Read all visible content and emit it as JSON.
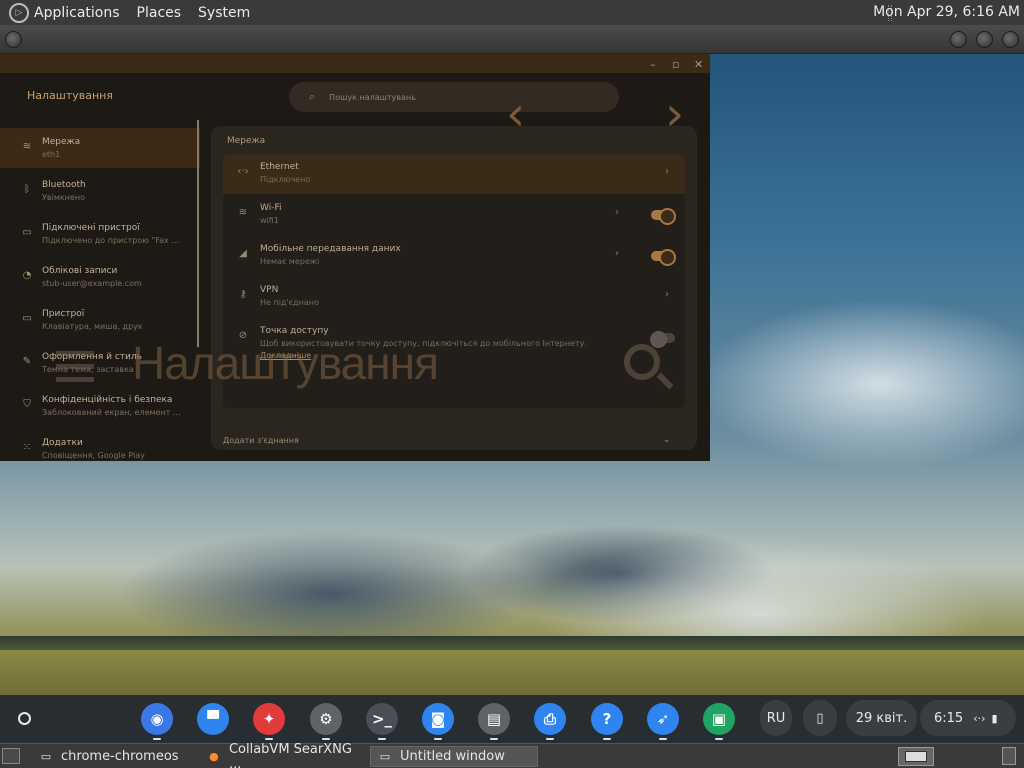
{
  "top_panel": {
    "menus": [
      "Applications",
      "Places",
      "System"
    ],
    "clock": "Mon Apr 29, 6:16 AM"
  },
  "settings": {
    "title": "Налаштування",
    "search_placeholder": "Пошук налаштувань",
    "overlay_title": "Налаштування",
    "nav": [
      {
        "title": "Мережа",
        "sub": "eth1",
        "icon": "wifi-icon"
      },
      {
        "title": "Bluetooth",
        "sub": "Увімкнено",
        "icon": "bluetooth-icon"
      },
      {
        "title": "Підключені пристрої",
        "sub": "Підключено до пристрою \"Fax ...",
        "icon": "connected-devices-icon"
      },
      {
        "title": "Облікові записи",
        "sub": "stub-user@example.com",
        "icon": "accounts-icon"
      },
      {
        "title": "Пристрої",
        "sub": "Клавіатура, миша, друк",
        "icon": "laptop-icon"
      },
      {
        "title": "Оформлення й стиль",
        "sub": "Темна тема, заставка",
        "icon": "palette-icon"
      },
      {
        "title": "Конфіденційність і безпека",
        "sub": "Заблокований екран, елемент ...",
        "icon": "shield-icon"
      },
      {
        "title": "Додатки",
        "sub": "Сповіщення, Google Play",
        "icon": "apps-grid-icon"
      }
    ],
    "section_heading": "Мережа",
    "rows": [
      {
        "title": "Ethernet",
        "sub": "Підключено",
        "icon": "ethernet-icon"
      },
      {
        "title": "Wi-Fi",
        "sub": "wifi1",
        "icon": "wifi-icon"
      },
      {
        "title": "Мобільне передавання даних",
        "sub": "Немає мережі",
        "icon": "cellular-icon"
      },
      {
        "title": "VPN",
        "sub": "Не під'єднано",
        "icon": "vpn-key-icon"
      },
      {
        "title": "Точка доступу",
        "sub": "Щоб використовувати точку доступу, підключіться до мобільного Інтернету.",
        "link": "Докладніше",
        "icon": "hotspot-off-icon"
      }
    ],
    "add_connection": "Додати з'єднання"
  },
  "shelf": {
    "apps": [
      {
        "name": "chrome",
        "color": "#3b78e7",
        "glyph": "◉"
      },
      {
        "name": "files",
        "color": "#2f84ef",
        "glyph": "▀"
      },
      {
        "name": "gallery",
        "color": "#e23b3b",
        "glyph": "✦"
      },
      {
        "name": "settings",
        "color": "#5f6368",
        "glyph": "⚙"
      },
      {
        "name": "terminal",
        "color": "#4a4f55",
        "glyph": ">_"
      },
      {
        "name": "camera",
        "color": "#2f84ef",
        "glyph": "◙"
      },
      {
        "name": "scanner",
        "color": "#5f6368",
        "glyph": "▤"
      },
      {
        "name": "print",
        "color": "#2f84ef",
        "glyph": "⎙"
      },
      {
        "name": "help",
        "color": "#2f84ef",
        "glyph": "?"
      },
      {
        "name": "launcher-rocket",
        "color": "#2f84ef",
        "glyph": "➶"
      },
      {
        "name": "id-card",
        "color": "#1fa463",
        "glyph": "▣"
      }
    ],
    "ime": "RU",
    "date": "29 квіт.",
    "time": "6:15"
  },
  "taskbar": {
    "tasks": [
      "chrome-chromeos",
      "CollabVM SearXNG ...",
      "Untitled window"
    ]
  },
  "colors": {
    "accent": "#a97740",
    "panel_bg": "#3a3a3a"
  }
}
